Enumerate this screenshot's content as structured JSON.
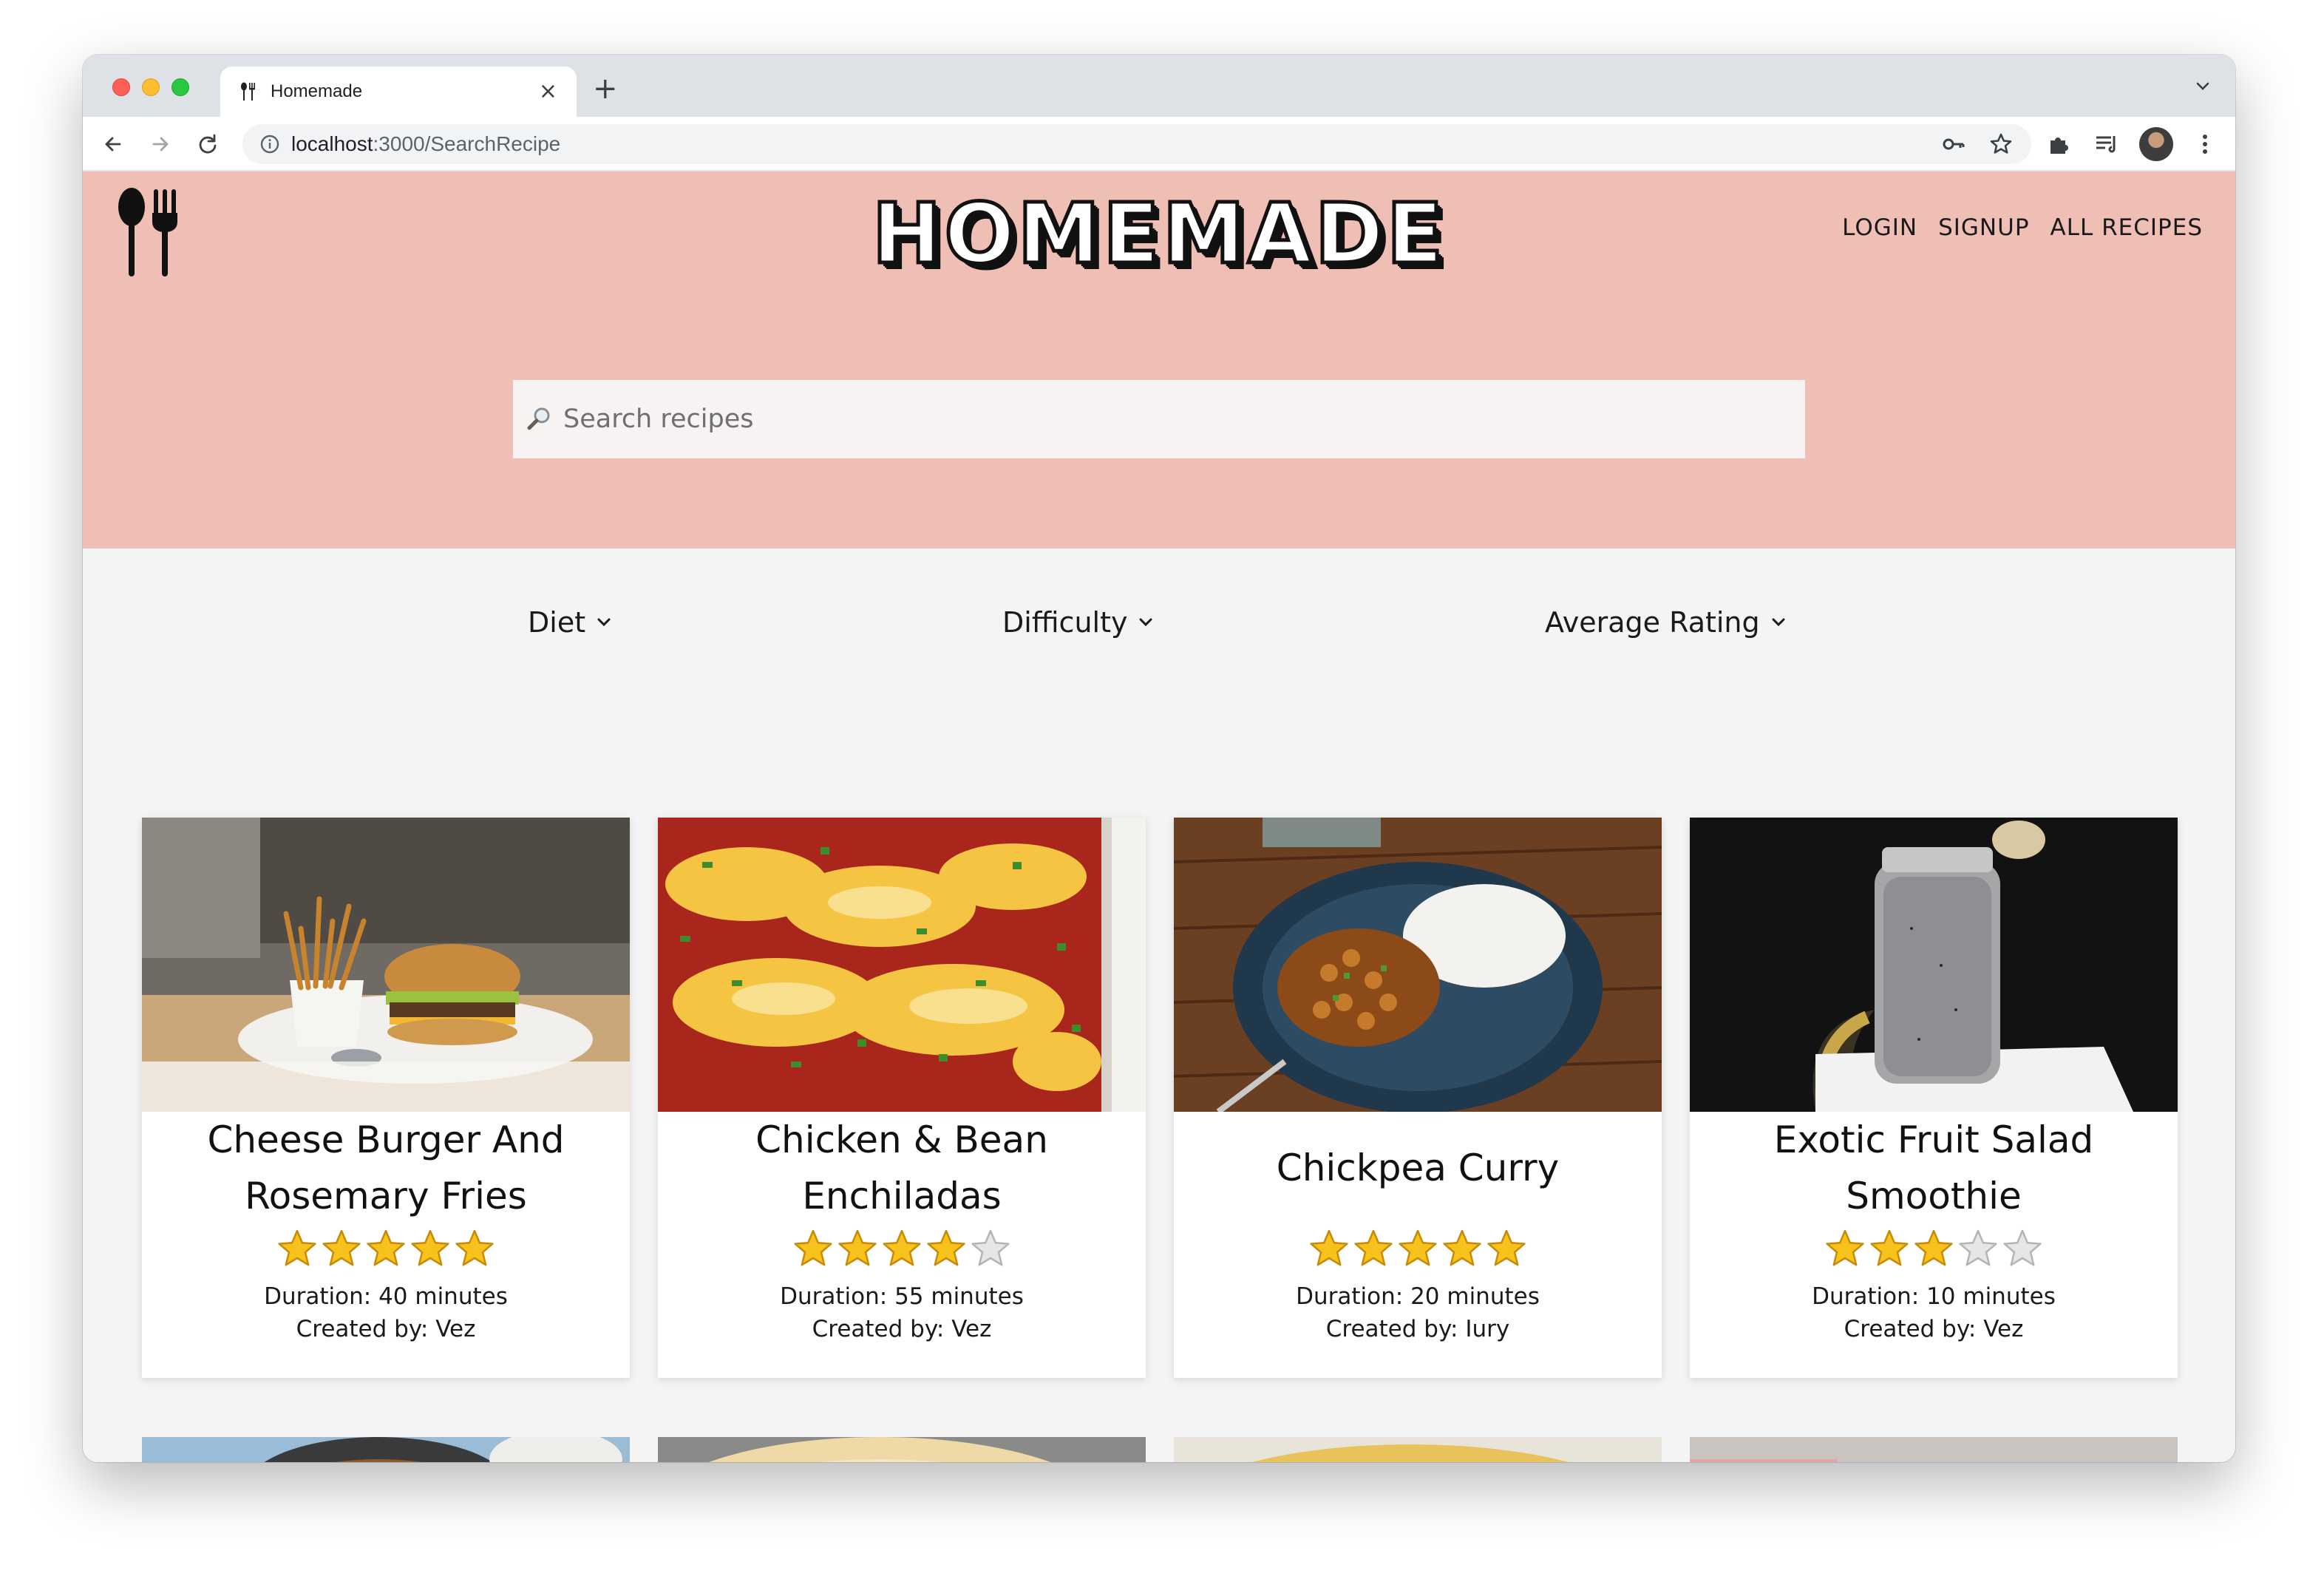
{
  "browser": {
    "tab_title": "Homemade",
    "new_tab": "+",
    "close": "×",
    "url_host": "localhost",
    "url_path": ":3000/SearchRecipe"
  },
  "header": {
    "brand": "HOMEMADE",
    "nav": [
      "LOGIN",
      "SIGNUP",
      "ALL RECIPES"
    ]
  },
  "search": {
    "placeholder": "Search recipes",
    "value": ""
  },
  "filters": [
    "Diet",
    "Difficulty",
    "Average Rating"
  ],
  "recipes": [
    {
      "title_line1": "Cheese Burger And",
      "title_line2": "Rosemary Fries",
      "rating": 5,
      "duration": "Duration: 40 minutes",
      "creator": "Created by: Vez",
      "image": "burger-and-fries"
    },
    {
      "title_line1": "Chicken & Bean",
      "title_line2": "Enchiladas",
      "rating": 4,
      "duration": "Duration: 55 minutes",
      "creator": "Created by: Vez",
      "image": "enchiladas"
    },
    {
      "title_line1": "Chickpea Curry",
      "title_line2": "",
      "rating": 5,
      "duration": "Duration: 20 minutes",
      "creator": "Created by: Iury",
      "image": "chickpea-curry"
    },
    {
      "title_line1": "Exotic Fruit Salad",
      "title_line2": "Smoothie",
      "rating": 3,
      "duration": "Duration: 10 minutes",
      "creator": "Created by: Vez",
      "image": "smoothie"
    }
  ],
  "colors": {
    "hero_bg": "#efbfb6",
    "page_bg": "#f4f4f4",
    "star_fill": "#f7c21b",
    "star_empty": "#e6e6e6"
  },
  "icons": {
    "logo": "spoon-fork-icon",
    "search": "magnifier-icon",
    "filter_chevron": "chevron-down-icon"
  }
}
